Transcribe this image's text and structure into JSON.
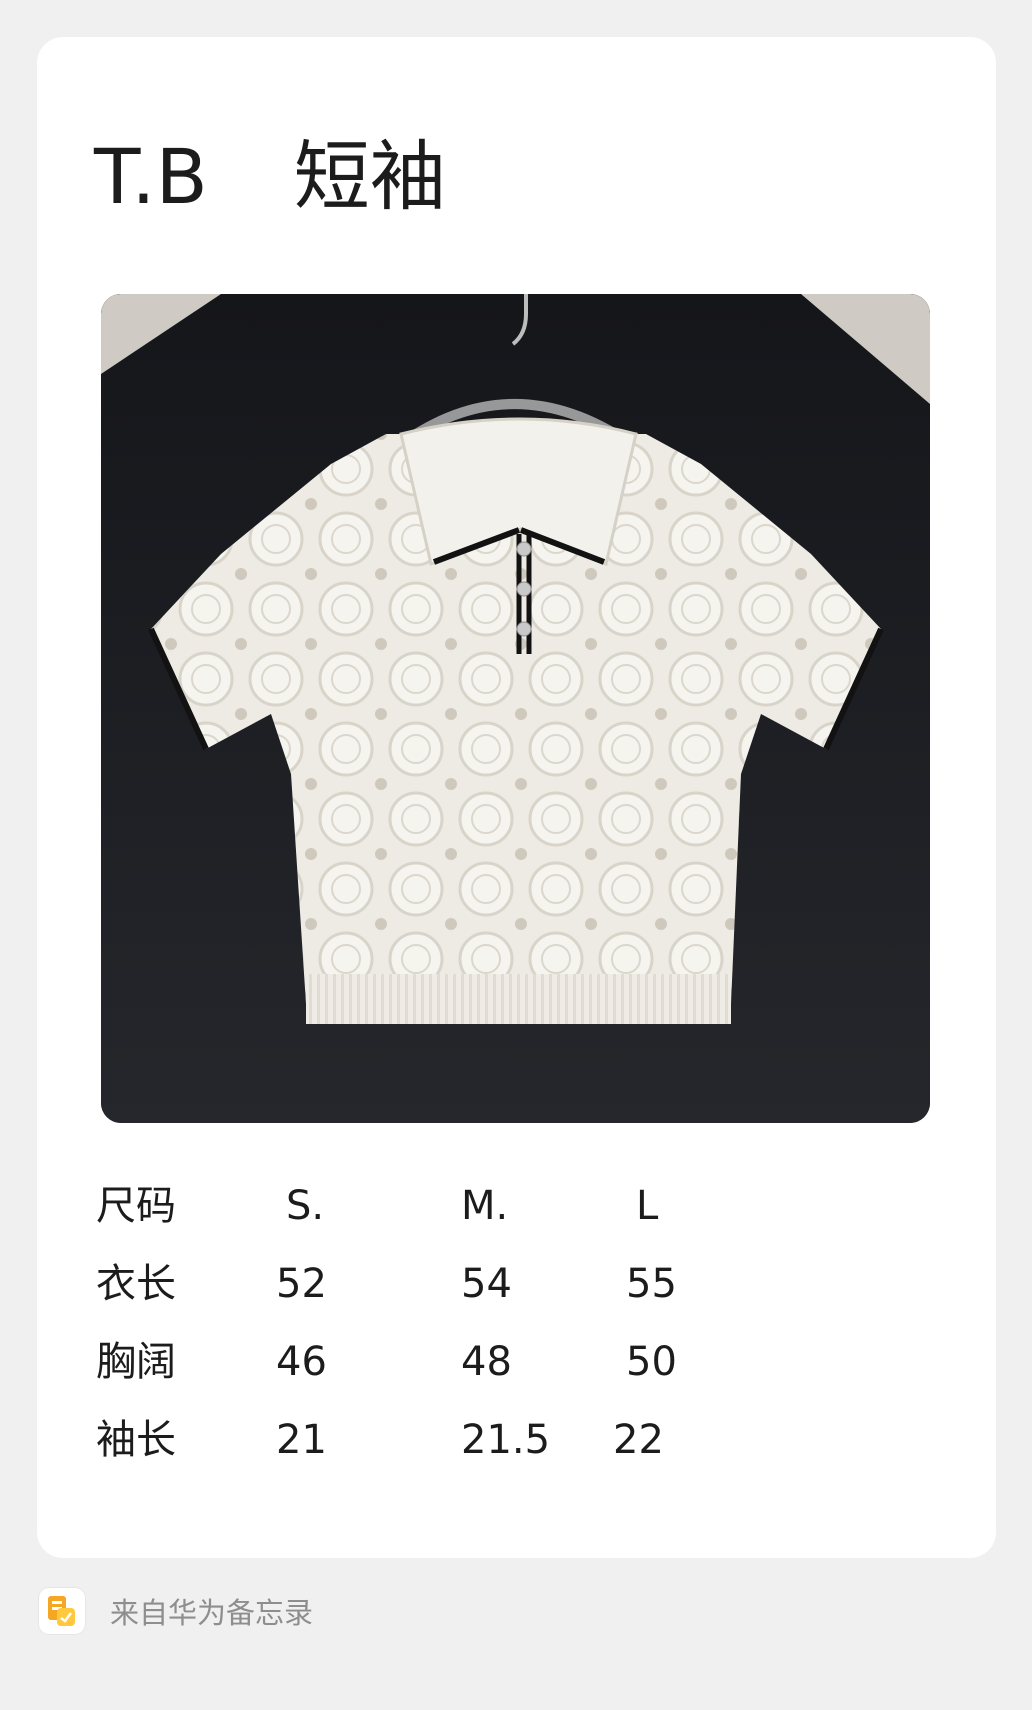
{
  "note": {
    "title_brand": "T.B",
    "title_item": "短袖",
    "photo_icon": "knit-polo-shirt-photo"
  },
  "size_table": {
    "rows": [
      {
        "label": "尺码",
        "values": [
          "S.",
          "M.",
          "L"
        ]
      },
      {
        "label": "衣长",
        "values": [
          "52",
          "54",
          "55"
        ]
      },
      {
        "label": "胸阔",
        "values": [
          "46",
          "48",
          "50"
        ]
      },
      {
        "label": "袖长",
        "values": [
          "21",
          "21.5",
          "22"
        ]
      }
    ]
  },
  "footer": {
    "icon": "huawei-notes-icon",
    "text": "来自华为备忘录"
  },
  "colors": {
    "background": "#f0f0f0",
    "card": "#ffffff",
    "text": "#1c1c1c",
    "footer_text": "#8e8e8e",
    "icon_orange": "#f5a623",
    "icon_yellow": "#ffc83d"
  }
}
